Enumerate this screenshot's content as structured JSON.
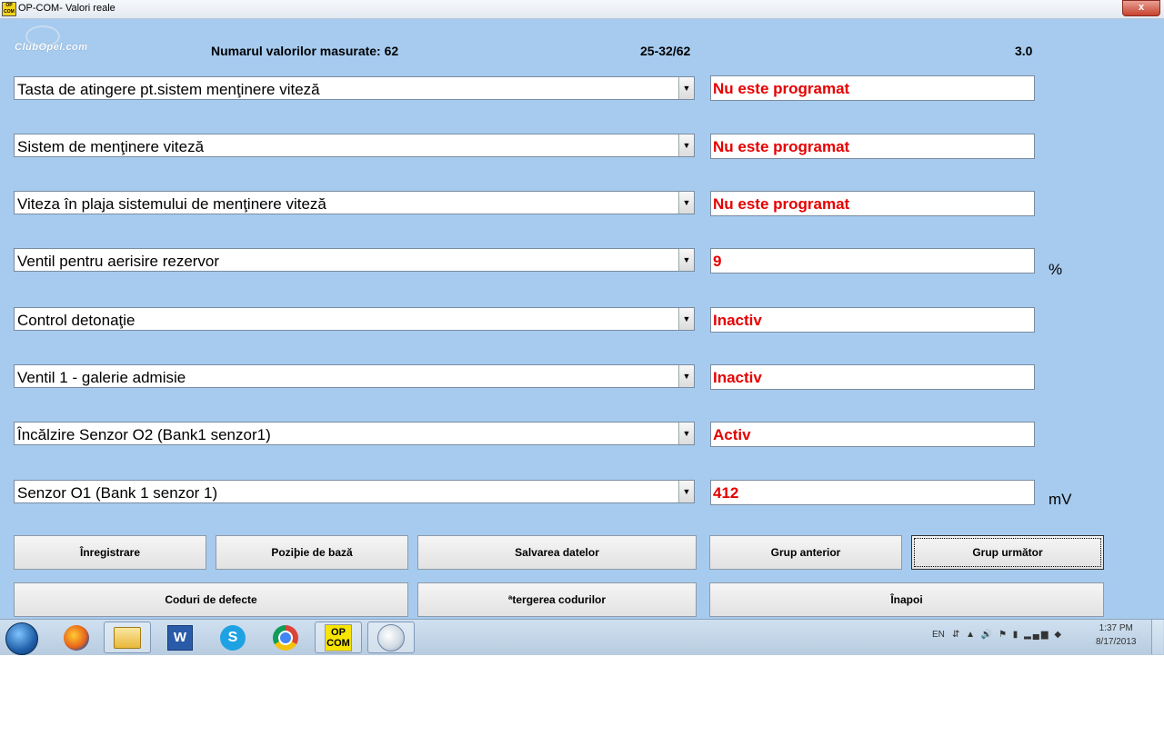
{
  "window": {
    "app_icon_text": "OP COM",
    "title": "OP-COM- Valori reale",
    "close_label": "x"
  },
  "header": {
    "logo_text": "ClubOpel.com",
    "count_label": "Numarul valorilor masurate: 62",
    "range_label": "25-32/62",
    "version_label": "3.0"
  },
  "rows": [
    {
      "label": "Tasta de atingere pt.sistem menţinere viteză",
      "value": "Nu este programat",
      "unit": ""
    },
    {
      "label": "Sistem de menţinere viteză",
      "value": "Nu este programat",
      "unit": ""
    },
    {
      "label": "Viteza în plaja sistemului de menţinere viteză",
      "value": "Nu este programat",
      "unit": ""
    },
    {
      "label": "Ventil pentru aerisire rezervor",
      "value": "9",
      "unit": "%"
    },
    {
      "label": "Control detonaţie",
      "value": "Inactiv",
      "unit": ""
    },
    {
      "label": "Ventil 1 - galerie admisie",
      "value": "Inactiv",
      "unit": ""
    },
    {
      "label": "Încălzire Senzor O2 (Bank1 senzor1)",
      "value": "Activ",
      "unit": ""
    },
    {
      "label": "Senzor O1 (Bank 1 senzor 1)",
      "value": "412",
      "unit": "mV"
    }
  ],
  "dropdown_arrow": "▼",
  "buttons": {
    "record": "Înregistrare",
    "base_position": "Poziþie de bază",
    "save_data": "Salvarea datelor",
    "prev_group": "Grup anterior",
    "next_group": "Grup următor",
    "fault_codes": "Coduri de defecte",
    "clear_codes": "ªtergerea codurilor",
    "back": "Înapoi"
  },
  "taskbar": {
    "apps": [
      "firefox-icon",
      "explorer-icon",
      "word-icon",
      "skype-icon",
      "chrome-icon",
      "opcom-icon",
      "paint-icon"
    ],
    "opcom_label": "OP COM",
    "word_label": "W",
    "skype_label": "S",
    "tray_lang": "EN",
    "tray_icons": "⇵ ▲ 🔊 ⚑ ▮ ▂▄▆ ◆",
    "time": "1:37 PM",
    "date": "8/17/2013"
  },
  "colors": {
    "client_bg": "#a6cbef",
    "value_text": "#e60000",
    "button_bg": "#ececec"
  }
}
